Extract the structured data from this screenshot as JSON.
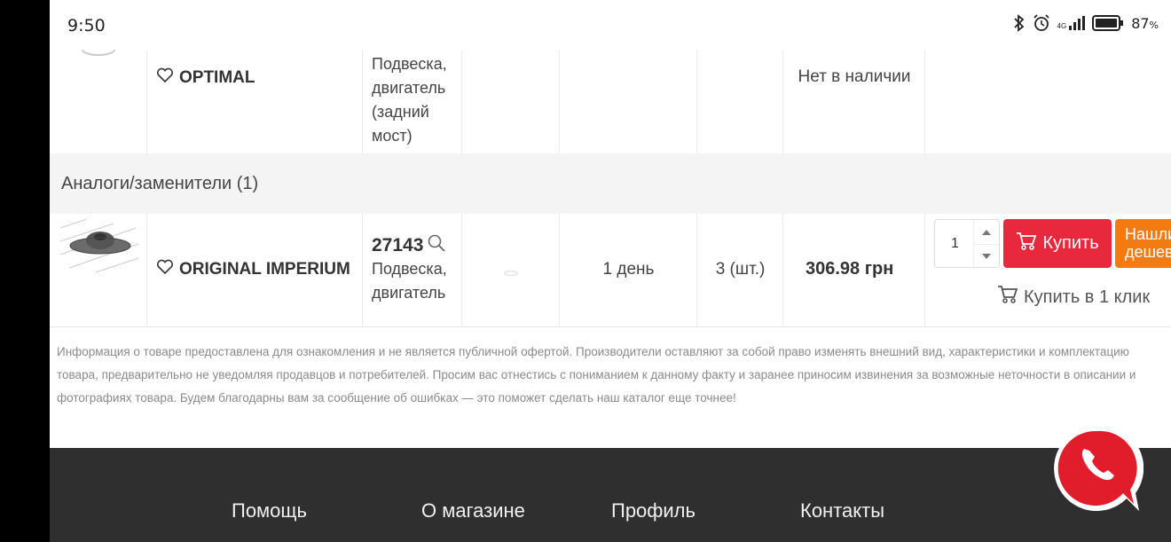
{
  "status_bar": {
    "time": "9:50",
    "battery": "87",
    "battery_unit": "%",
    "network": "4G"
  },
  "top_row": {
    "brand": "OPTIMAL",
    "application": "Подвеска, двигатель (задний мост)",
    "availability": "Нет в наличии"
  },
  "analogs_header": "Аналоги/заменители (1)",
  "product": {
    "brand": "ORIGINAL IMPERIUM",
    "code": "27143",
    "application": "Подвеска, двигатель",
    "delivery": "1 день",
    "stock": "3 (шт.)",
    "price": "306.98 грн",
    "quantity": "1",
    "buy_label": "Купить",
    "cheaper_label": "Нашли дешевле",
    "one_click_label": "Купить в 1 клик"
  },
  "disclaimer": "Информация о товаре предоставлена для ознакомления и не является публичной офертой. Производители оставляют за собой право изменять внешний вид, характеристики и комплектацию товара, предварительно не уведомляя продавцов и потребителей. Просим вас отнестись с пониманием к данному факту и заранее приносим извинения за возможные неточности в описании и фотографиях товара. Будем благодарны вам за сообщение об ошибках — это поможет сделать наш каталог еще точнее!",
  "footer": {
    "links": [
      "Помощь",
      "О магазине",
      "Профиль",
      "Контакты"
    ]
  },
  "colors": {
    "buy": "#e8283d",
    "cheaper": "#f47b12",
    "footer": "#2f2f2f",
    "fab": "#e21d2b"
  },
  "icons": [
    "bluetooth-icon",
    "alarm-icon",
    "signal-icon",
    "battery-icon",
    "heart-icon",
    "search-icon",
    "cart-icon",
    "phone-icon"
  ]
}
